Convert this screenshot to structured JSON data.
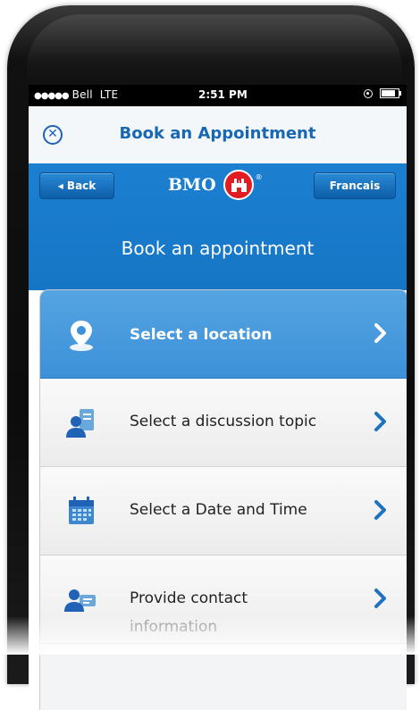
{
  "status_bar": {
    "carrier": "Bell",
    "network": "LTE",
    "time": "2:51 PM"
  },
  "title_bar": {
    "title": "Book an Appointment"
  },
  "header": {
    "back_label": "◂ Back",
    "logo_text": "BMO",
    "language_label": "Francais",
    "heading": "Book an appointment"
  },
  "menu": {
    "items": [
      {
        "label": "Select a location",
        "icon": "location-pin-icon",
        "selected": true
      },
      {
        "label": "Select a discussion topic",
        "icon": "discussion-topic-icon",
        "selected": false
      },
      {
        "label": "Select a Date and Time",
        "icon": "calendar-icon",
        "selected": false
      },
      {
        "label": "Provide contact",
        "sublabel": "information",
        "icon": "contact-card-icon",
        "selected": false
      }
    ]
  },
  "colors": {
    "brand_blue": "#1676c6",
    "accent_blue": "#1767b3",
    "selected_blue": "#3c91d8",
    "logo_red": "#e31b23"
  }
}
